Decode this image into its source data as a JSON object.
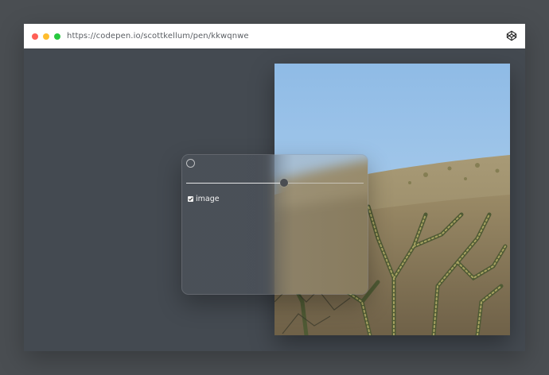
{
  "browser": {
    "url": "https://codepen.io/scottkellum/pen/kkwqnwe",
    "icon": "codepen-icon"
  },
  "panel": {
    "slider_value_percent": 55,
    "checkbox": {
      "label": "image",
      "checked": true
    }
  },
  "colors": {
    "page_background": "#4a4e52",
    "viewport_background": "#444a51",
    "sky": "#9cc4e8",
    "accent_thumb": "#4a4d52"
  }
}
